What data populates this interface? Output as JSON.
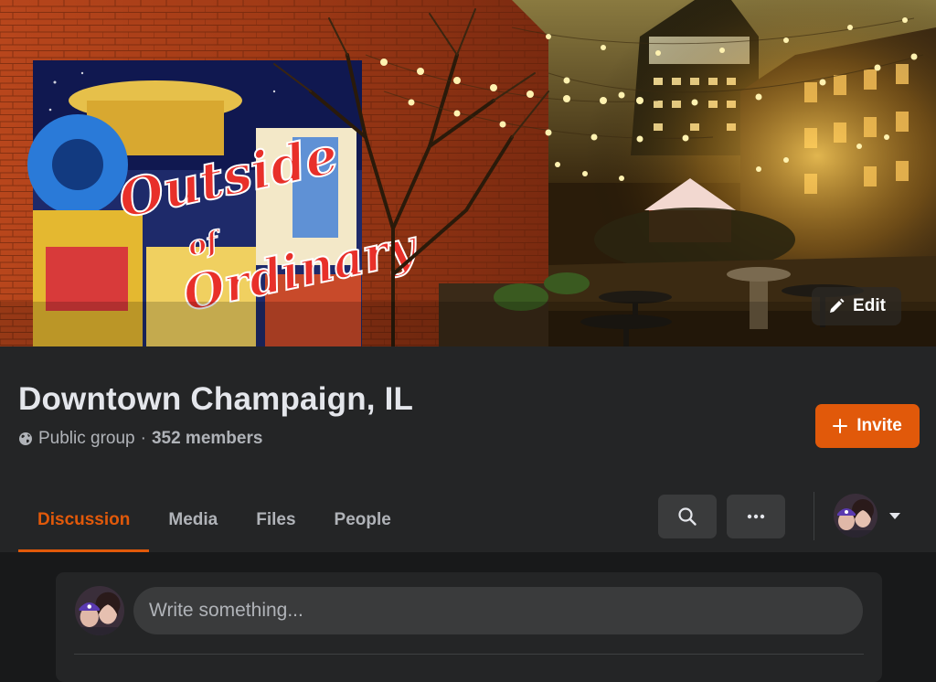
{
  "cover": {
    "edit_label": "Edit"
  },
  "group": {
    "name": "Downtown Champaign, IL",
    "privacy": "Public group",
    "separator": "·",
    "members": "352 members",
    "invite_label": "Invite"
  },
  "tabs": [
    {
      "label": "Discussion",
      "active": true
    },
    {
      "label": "Media",
      "active": false
    },
    {
      "label": "Files",
      "active": false
    },
    {
      "label": "People",
      "active": false
    }
  ],
  "actions": {
    "search_icon": "search-icon",
    "more_icon": "more-horizontal-icon",
    "profile_caret": "caret-down-icon"
  },
  "composer": {
    "placeholder": "Write something..."
  },
  "colors": {
    "accent": "#e1590a",
    "surface": "#242526",
    "background": "#18191a",
    "button": "#3a3b3c"
  }
}
